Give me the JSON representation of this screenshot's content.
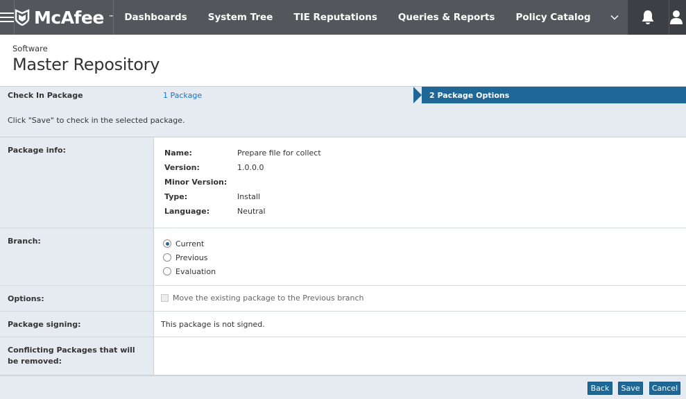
{
  "topbar": {
    "menu_icon": "hamburger-icon",
    "brand": "McAfee",
    "brand_mark": "™",
    "nav": [
      "Dashboards",
      "System Tree",
      "TIE Reputations",
      "Queries & Reports",
      "Policy Catalog"
    ],
    "more_icon": "chevron-down-icon",
    "notifications_icon": "bell-icon",
    "user_icon": "user-icon"
  },
  "page": {
    "breadcrumb": "Software",
    "title": "Master Repository"
  },
  "wizard": {
    "title": "Check In Package",
    "step1": "1 Package",
    "step2": "2 Package Options",
    "hint": "Click \"Save\" to check in the selected package."
  },
  "form": {
    "package_info": {
      "label": "Package info:",
      "fields": [
        {
          "key": "Name:",
          "value": "Prepare file for collect"
        },
        {
          "key": "Version:",
          "value": "1.0.0.0"
        },
        {
          "key": "Minor Version:",
          "value": ""
        },
        {
          "key": "Type:",
          "value": "Install"
        },
        {
          "key": "Language:",
          "value": "Neutral"
        }
      ]
    },
    "branch": {
      "label": "Branch:",
      "options": [
        "Current",
        "Previous",
        "Evaluation"
      ],
      "selected": "Current"
    },
    "options": {
      "label": "Options:",
      "checkbox_label": "Move the existing package to the Previous branch",
      "checked": false,
      "disabled": true
    },
    "signing": {
      "label": "Package signing:",
      "value": "This package is not signed."
    },
    "conflicting": {
      "label": "Conflicting Packages that will be removed:"
    }
  },
  "footer": {
    "back": "Back",
    "save": "Save",
    "cancel": "Cancel"
  },
  "colors": {
    "topbar": "#53565a",
    "topbar_dark": "#3c3f43",
    "accent": "#1e6796",
    "panel": "#e5ebf1",
    "link": "#1a73c9"
  }
}
